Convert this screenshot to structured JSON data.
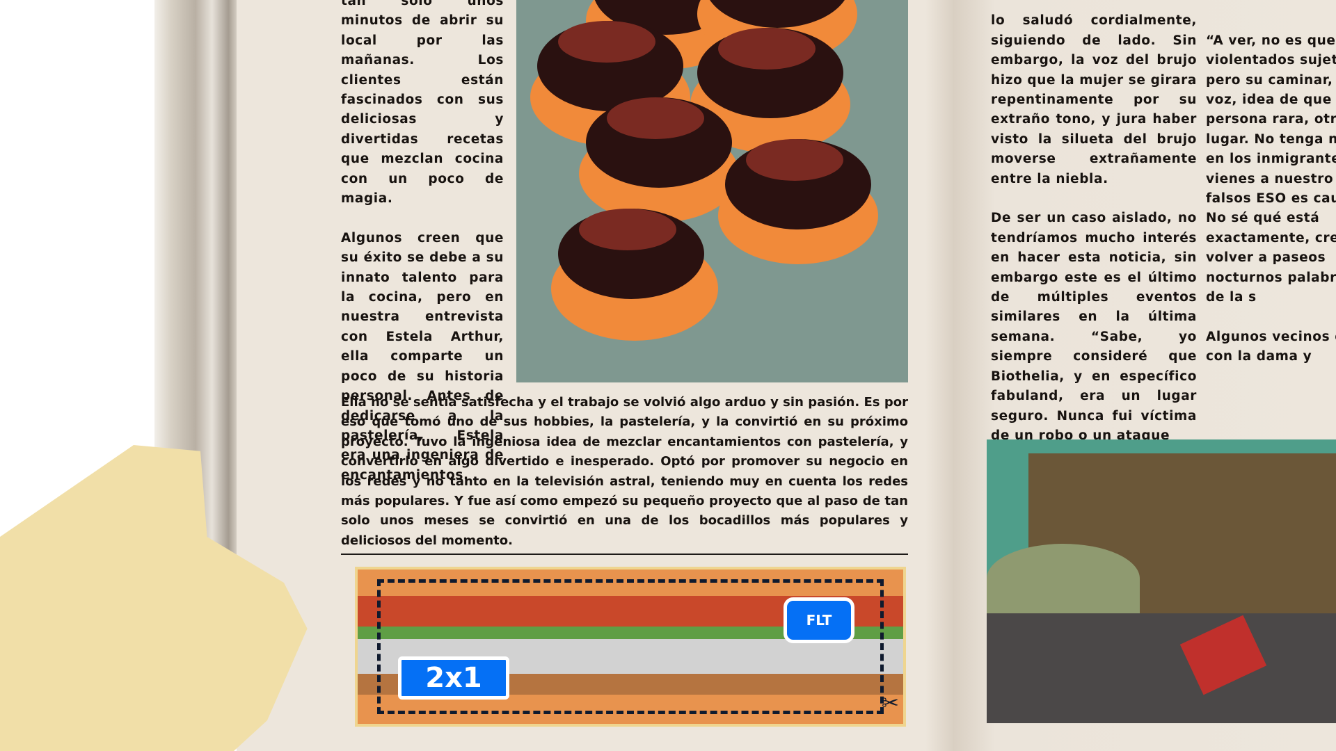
{
  "article_left": {
    "col_a": [
      "tan solo unos minutos de abrir su local por las mañanas. Los clientes están fascinados con sus deliciosas y divertidas recetas que mezclan cocina con un poco de magia.",
      "Algunos creen que su éxito se debe a su innato talento para la cocina, pero en nuestra entrevista con Estela Arthur, ella comparte un poco de su historia personal. Antes de dedicarse a la pastelería, Estela era una ingeniera de encantamientos."
    ],
    "wide": "Ella no se sentía satisfecha y el trabajo se volvió algo arduo y sin pasión. Es por eso que tomó uno de sus hobbies, la pastelería, y la convirtió en su próximo proyecto. Tuvo la ingeniosa idea de mezclar encantamientos con pastelería, y convertirlo en algo divertido e inesperado. Optó por promover su negocio en los redes y no tanto en la televisión astral, teniendo muy en cuenta los redes más populares. Y fue así como empezó su pequeño proyecto que al paso de tan solo unos meses se convirtió en una de los bocadillos más populares y deliciosos del momento.",
    "coupon": {
      "badge_offer": "2x1",
      "badge_small": "FLT"
    }
  },
  "article_right": {
    "col_b": [
      "lo saludó cordialmente, siguiendo de lado. Sin embargo, la voz del brujo hizo que la mujer se girara repentinamente por su extraño tono, y jura haber visto la silueta del brujo moverse extrañamente entre la niebla.",
      "De ser un caso aislado, no tendríamos mucho interés en hacer esta noticia, sin embargo este es el último de múltiples eventos similares en la última semana. “Sabe, yo siempre consideré que Biothelia, y en específico fabuland, era un lugar seguro. Nunca fui víctima de un robo o un ataque"
    ],
    "col_c": [
      "“A ver, no es que sido violentados sujeto, pero su caminar, su voz, idea de que ésta persona rara, otro lugar. No tenga nada en los inmigrantes, vienes a nuestro bajo falsos ESO es causa No sé qué está exactamente, creo volver a paseos nocturnos palabras de la s",
      "Algunos vecinos c con la dama y"
    ]
  },
  "colors": {
    "paper": "#ede6dc",
    "badge": "#0570f5",
    "ink": "#17120f"
  }
}
